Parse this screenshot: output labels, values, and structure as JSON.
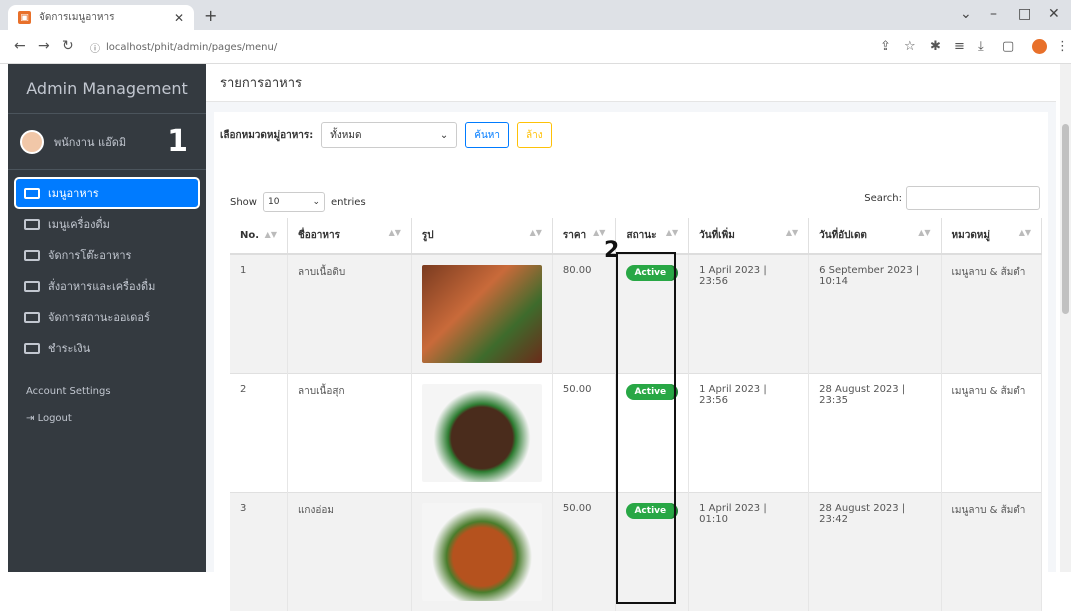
{
  "browser": {
    "tab_title": "จัดการเมนูอาหาร",
    "url": "localhost/phit/admin/pages/menu/"
  },
  "sidebar": {
    "brand": "Admin Management",
    "user_name": "พนักงาน แอ๊ดมิ",
    "marker": "1",
    "items": [
      {
        "label": "เมนูอาหาร"
      },
      {
        "label": "เมนูเครื่องดื่ม"
      },
      {
        "label": "จัดการโต๊ะอาหาร"
      },
      {
        "label": "สั่งอาหารและเครื่องดื่ม"
      },
      {
        "label": "จัดการสถานะออเดอร์"
      },
      {
        "label": "ชำระเงิน"
      }
    ],
    "settings_label": "Account Settings",
    "logout_label": "Logout"
  },
  "page": {
    "title": "รายการอาหาร",
    "filter_label": "เลือกหมวดหมู่อาหาร:",
    "filter_value": "ทั้งหมด",
    "search_btn": "ค้นหา",
    "reset_btn": "ล้าง",
    "show_label": "Show",
    "entries_value": "10",
    "entries_label": "entries",
    "search_label": "Search:",
    "marker": "2"
  },
  "table": {
    "columns": [
      "No.",
      "ชื่ออาหาร",
      "รูป",
      "ราคา",
      "สถานะ",
      "วันที่เพิ่ม",
      "วันที่อัปเดต",
      "หมวดหมู่"
    ],
    "rows": [
      {
        "no": "1",
        "name": "ลาบเนื้อดิบ",
        "price": "80.00",
        "status": "Active",
        "added": "1 April 2023 | 23:56",
        "updated": "6 September 2023 | 10:14",
        "category": "เมนูลาบ & ส้มตำ"
      },
      {
        "no": "2",
        "name": "ลาบเนื้อสุก",
        "price": "50.00",
        "status": "Active",
        "added": "1 April 2023 | 23:56",
        "updated": "28 August 2023 | 23:35",
        "category": "เมนูลาบ & ส้มตำ"
      },
      {
        "no": "3",
        "name": "แกงอ่อม",
        "price": "50.00",
        "status": "Active",
        "added": "1 April 2023 | 01:10",
        "updated": "28 August 2023 | 23:42",
        "category": "เมนูลาบ & ส้มตำ"
      }
    ]
  }
}
